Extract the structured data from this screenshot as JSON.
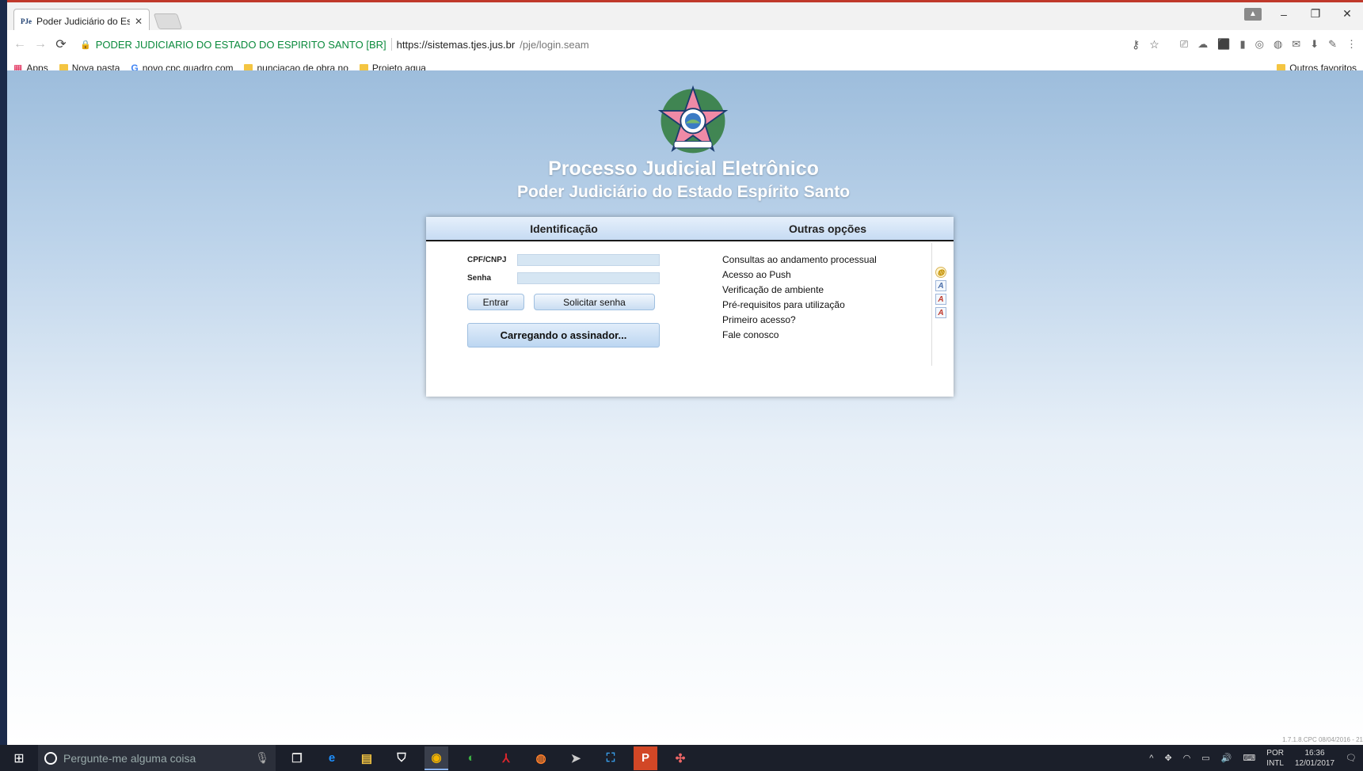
{
  "browser": {
    "tab_favicon": "PJe",
    "tab_title": "Poder Judiciário do Estad",
    "tab_close": "✕",
    "window_controls": {
      "minimize": "–",
      "restore": "❐",
      "close": "✕"
    },
    "profile": "▲",
    "nav": {
      "back": "←",
      "forward": "→",
      "reload": "⟳"
    },
    "address": {
      "lock": "🔒",
      "site_identity": "PODER JUDICIARIO DO ESTADO DO ESPIRITO SANTO [BR]",
      "url_host": "https://sistemas.tjes.jus.br",
      "url_path": "/pje/login.seam"
    },
    "omni_icons": {
      "key": "⚷",
      "star": "☆"
    },
    "extension_icons": [
      "⎚",
      "☁",
      "⬛",
      "▮",
      "◎",
      "◍",
      "✉",
      "⬇",
      "✎",
      "⋮"
    ],
    "bookmarks": [
      {
        "label": "Apps",
        "type": "apps"
      },
      {
        "label": "Nova pasta",
        "type": "folder"
      },
      {
        "label": "novo cpc quadro com",
        "type": "google"
      },
      {
        "label": "nunciacao de obra no",
        "type": "folder"
      },
      {
        "label": "Projeto agua",
        "type": "folder"
      }
    ],
    "bookmarks_right": "Outros favoritos"
  },
  "page": {
    "title": "Processo Judicial Eletrônico",
    "subtitle": "Poder Judiciário do Estado Espírito Santo",
    "login": {
      "identification_header": "Identificação",
      "other_options_header": "Outras opções",
      "cpf_label": "CPF/CNPJ",
      "cpf_value": "",
      "password_label": "Senha",
      "password_value": "",
      "enter_button": "Entrar",
      "request_password_button": "Solicitar senha",
      "signer_button": "Carregando o assinador..."
    },
    "options": [
      "Consultas ao andamento processual",
      "Acesso ao Push",
      "Verificação de ambiente",
      "Pré-requisitos para utilização",
      "Primeiro acesso?",
      "Fale conosco"
    ],
    "option_icons": [
      "globe-icon",
      "font-a-icon",
      "font-a-flag-icon",
      "font-a-flag-icon"
    ],
    "version": "1.7.1.8.CPC 08/04/2016 - 21"
  },
  "taskbar": {
    "start": "⊞",
    "search_placeholder": "Pergunte-me alguma coisa",
    "mic": "🎙",
    "apps": [
      "❐",
      "e",
      "▤",
      "⛉",
      "◉",
      "◐",
      "⅄",
      "◍",
      "➤",
      "⛶",
      "P",
      "✣"
    ],
    "tray": {
      "chevron": "^",
      "icons": [
        "✥",
        "◠",
        "▭",
        "🔊",
        "⌨"
      ]
    },
    "language": [
      "POR",
      "INTL"
    ],
    "time": "16:36",
    "date": "12/01/2017",
    "notification": "🗨"
  },
  "colors": {
    "accent_green": "#0a8a3c",
    "header_gradient_top": "#e6f0fb",
    "header_gradient_bottom": "#c6dbf3",
    "page_top": "#9dbddc"
  }
}
